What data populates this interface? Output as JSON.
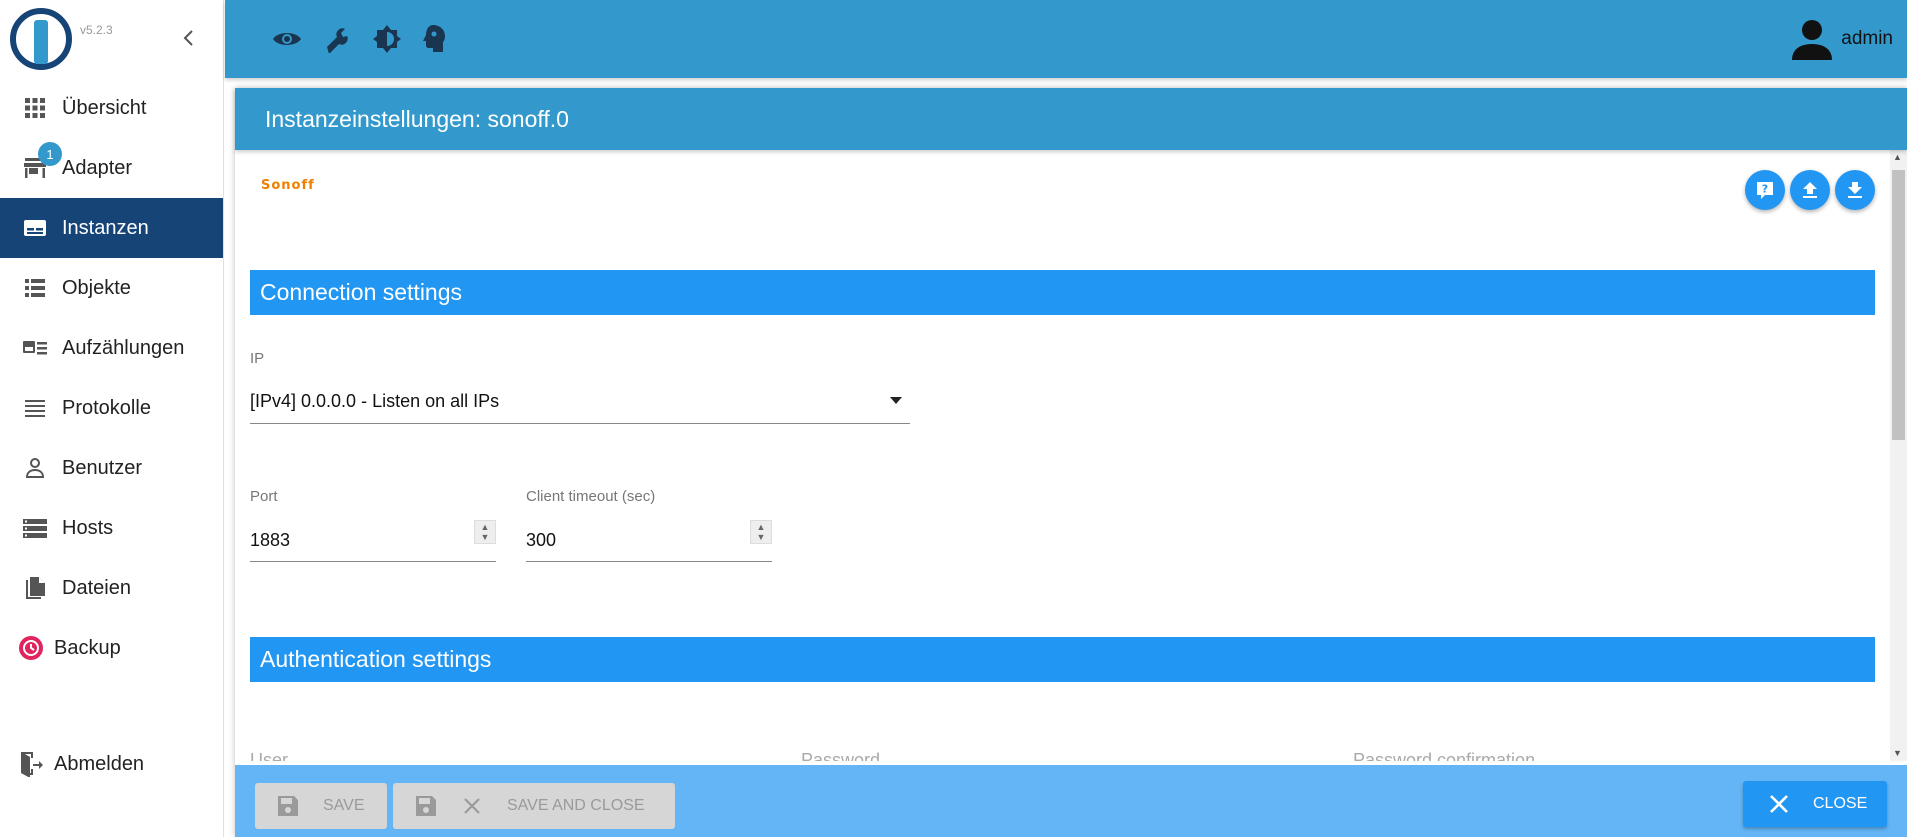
{
  "app": {
    "version": "v5.2.3"
  },
  "sidebar": {
    "items": [
      {
        "label": "Übersicht",
        "icon": "grid-icon"
      },
      {
        "label": "Adapter",
        "icon": "store-icon",
        "badge": "1"
      },
      {
        "label": "Instanzen",
        "icon": "instances-icon",
        "active": true
      },
      {
        "label": "Objekte",
        "icon": "list-icon"
      },
      {
        "label": "Aufzählungen",
        "icon": "enum-icon"
      },
      {
        "label": "Protokolle",
        "icon": "logs-icon"
      },
      {
        "label": "Benutzer",
        "icon": "user-icon"
      },
      {
        "label": "Hosts",
        "icon": "hosts-icon"
      },
      {
        "label": "Dateien",
        "icon": "files-icon"
      },
      {
        "label": "Backup",
        "icon": "backup-icon"
      }
    ],
    "logout_label": "Abmelden"
  },
  "topbar": {
    "icons": [
      "eye-icon",
      "wrench-icon",
      "theme-icon",
      "expert-mode-icon"
    ],
    "user": "admin"
  },
  "dialog": {
    "title": "Instanzeinstellungen: sonoff.0",
    "logo_text": "Sonoff",
    "connection": {
      "heading": "Connection settings",
      "ip_label": "IP",
      "ip_value": "[IPv4] 0.0.0.0 - Listen on all IPs",
      "port_label": "Port",
      "port_value": "1883",
      "timeout_label": "Client timeout (sec)",
      "timeout_value": "300"
    },
    "authentication": {
      "heading": "Authentication settings",
      "user_label": "User",
      "password_label": "Password",
      "password_confirm_label": "Password confirmation"
    },
    "footer": {
      "save_label": "SAVE",
      "save_close_label": "SAVE AND CLOSE",
      "close_label": "CLOSE"
    }
  },
  "colors": {
    "topbar": "#3399cc",
    "sidebar_active": "#164477",
    "section": "#2196f3",
    "footer": "#64b5f6",
    "backup_icon": "#e0245e"
  }
}
